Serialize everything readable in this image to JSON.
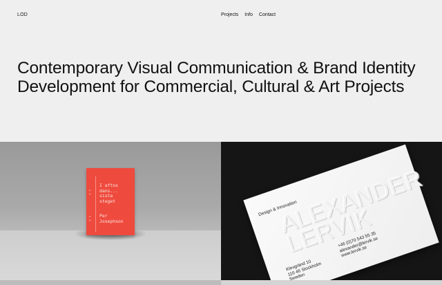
{
  "header": {
    "logo": "LOD",
    "nav": [
      {
        "label": "Projects"
      },
      {
        "label": "Info"
      },
      {
        "label": "Contact"
      }
    ]
  },
  "hero": {
    "headline": "Contemporary Visual Communication & Brand Identity Development for Commercial, Cultural & Art Projects"
  },
  "projects": [
    {
      "card_text": {
        "quote": [
          "I aftos",
          "dans...",
          "sista",
          "steget"
        ],
        "signature": [
          "Per",
          "Josephson"
        ]
      }
    },
    {
      "card_text": {
        "tag": "Design & Innovation",
        "name": [
          "ALEXANDER",
          "LERVIK"
        ],
        "address": [
          "Klevgränd 10",
          "116 46 Stockholm",
          "Sweden"
        ],
        "contact": [
          "+46 (0)70 543 55 35",
          "alexander@lervik.se",
          "www.lervik.se"
        ]
      }
    }
  ],
  "colors": {
    "background": "#efefef",
    "accent_red": "#ee4b3e",
    "text": "#111111"
  }
}
